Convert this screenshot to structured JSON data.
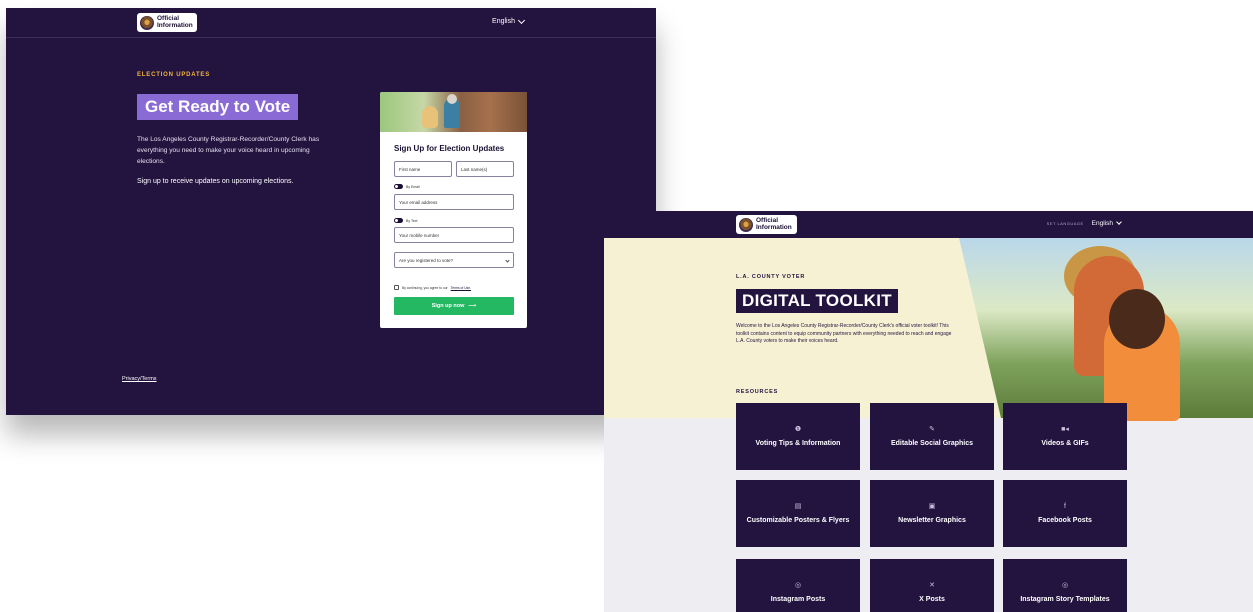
{
  "screen1": {
    "logo_text": "Official Information",
    "language": "English",
    "eyebrow": "ELECTION UPDATES",
    "hero_title": "Get Ready to Vote",
    "body": "The Los Angeles County Registrar-Recorder/County Clerk has everything you need to make your voice heard in upcoming elections.",
    "body_cta": "Sign up to receive updates on upcoming elections.",
    "privacy_link": "Privacy/Terms",
    "form": {
      "title": "Sign Up for Election Updates",
      "first_name_placeholder": "First name",
      "last_name_placeholder": "Last name(s)",
      "by_email_label": "By Email",
      "email_placeholder": "Your email address",
      "by_text_label": "By Text",
      "mobile_placeholder": "Your mobile number",
      "registered_select": "Are you registered to vote?",
      "terms_text": "By continuing, you agree to our",
      "terms_link": "Terms of Use.",
      "submit_label": "Sign up now",
      "submit_color": "#25b863"
    }
  },
  "screen2": {
    "logo_text": "Official Information",
    "set_language": "SET LANGUAGE",
    "language": "English",
    "eyebrow": "L.A. COUNTY VOTER",
    "hero_title": "DIGITAL TOOLKIT",
    "body": "Welcome to the Los Angeles County Registrar-Recorder/County Clerk's official voter toolkit! This toolkit contains content to equip community partners with everything needed to reach and engage L.A. County voters to make their voices heard.",
    "resources_label": "RESOURCES",
    "tiles": [
      {
        "icon": "info-icon",
        "glyph": "❶",
        "label": "Voting Tips & Information"
      },
      {
        "icon": "edit-icon",
        "glyph": "✎",
        "label": "Editable Social Graphics"
      },
      {
        "icon": "video-icon",
        "glyph": "■◂",
        "label": "Videos & GIFs"
      },
      {
        "icon": "file-icon",
        "glyph": "▤",
        "label": "Customizable Posters & Flyers"
      },
      {
        "icon": "newsletter-icon",
        "glyph": "▣",
        "label": "Newsletter Graphics"
      },
      {
        "icon": "facebook-icon",
        "glyph": "f",
        "label": "Facebook Posts"
      },
      {
        "icon": "instagram-icon",
        "glyph": "◎",
        "label": "Instagram Posts"
      },
      {
        "icon": "x-twitter-icon",
        "glyph": "✕",
        "label": "X Posts"
      },
      {
        "icon": "instagram-icon",
        "glyph": "◎",
        "label": "Instagram Story Templates"
      }
    ]
  },
  "colors": {
    "navy": "#22133f",
    "purple_highlight": "#8a6bd6",
    "gold_eyebrow": "#f2b63c",
    "cream": "#f7f1d4",
    "green_button": "#25b863"
  }
}
